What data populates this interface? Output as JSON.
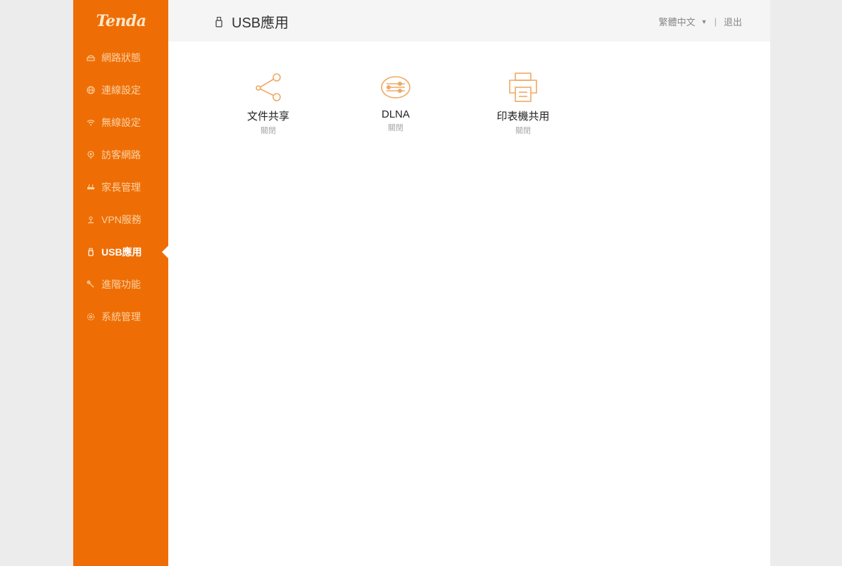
{
  "brand": {
    "logo_text": "Tenda",
    "accent_color": "#ee6e05"
  },
  "sidebar": {
    "items": [
      {
        "label": "網路狀態",
        "icon": "router-icon",
        "active": false
      },
      {
        "label": "連線設定",
        "icon": "globe-icon",
        "active": false
      },
      {
        "label": "無線設定",
        "icon": "wifi-icon",
        "active": false
      },
      {
        "label": "訪客網路",
        "icon": "guest-icon",
        "active": false
      },
      {
        "label": "家長管理",
        "icon": "parental-control-icon",
        "active": false
      },
      {
        "label": "VPN服務",
        "icon": "vpn-icon",
        "active": false
      },
      {
        "label": "USB應用",
        "icon": "usb-icon",
        "active": true
      },
      {
        "label": "進階功能",
        "icon": "wrench-icon",
        "active": false
      },
      {
        "label": "系統管理",
        "icon": "gear-icon",
        "active": false
      }
    ]
  },
  "header": {
    "title": "USB應用",
    "title_icon": "usb-icon",
    "language": "繁體中文",
    "separator": "|",
    "logout_label": "退出"
  },
  "main": {
    "apps": [
      {
        "name": "文件共享",
        "status": "關閉",
        "icon": "share-icon"
      },
      {
        "name": "DLNA",
        "status": "關閉",
        "icon": "dlna-icon"
      },
      {
        "name": "印表機共用",
        "status": "關閉",
        "icon": "printer-icon"
      }
    ]
  }
}
